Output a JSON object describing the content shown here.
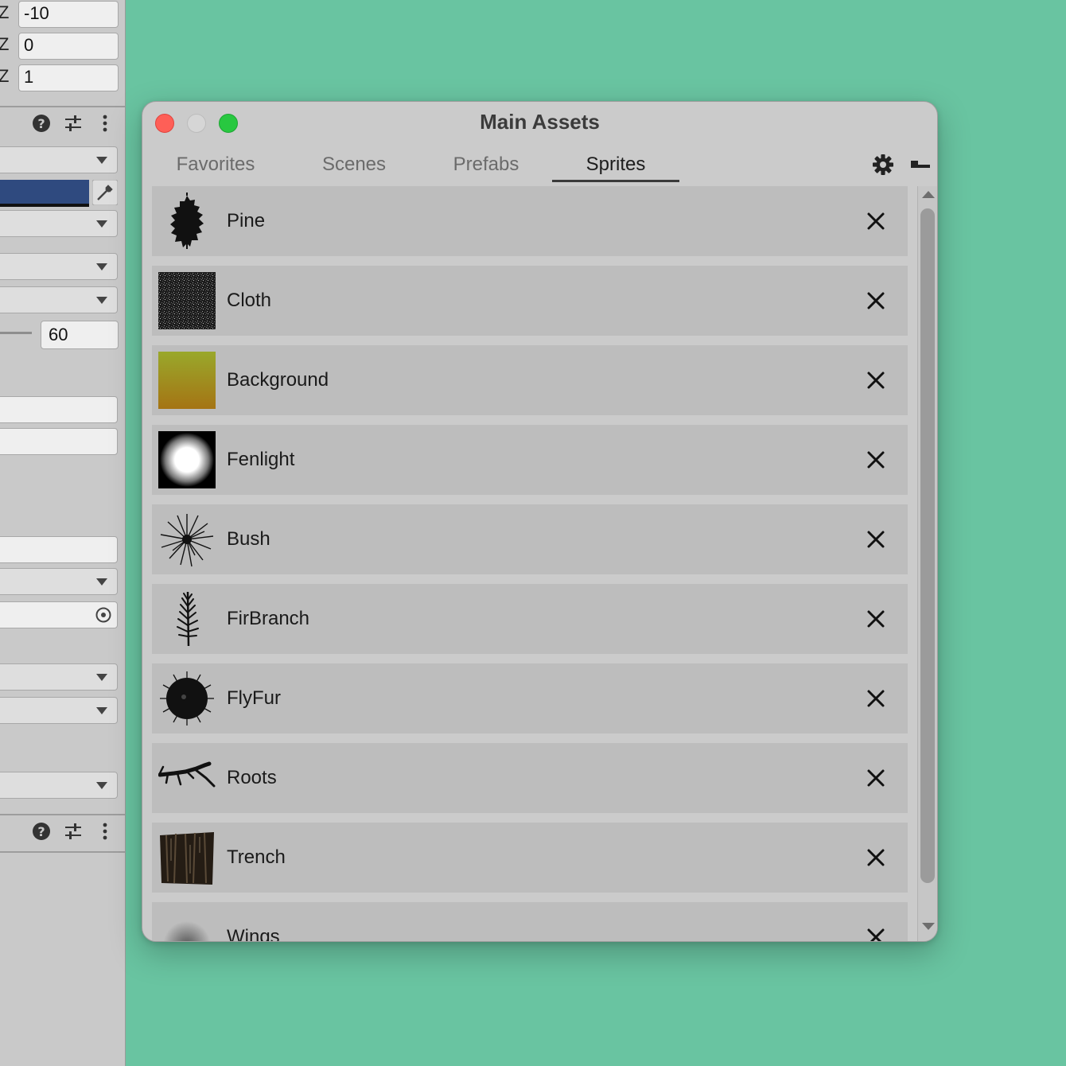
{
  "inspector": {
    "axis_label": "Z",
    "field_values": [
      "-10",
      "0",
      "1"
    ],
    "slider_value": "60",
    "color_swatch": "#2f4a7f"
  },
  "window": {
    "title": "Main Assets",
    "tabs": [
      {
        "label": "Favorites",
        "active": false
      },
      {
        "label": "Scenes",
        "active": false
      },
      {
        "label": "Prefabs",
        "active": false
      },
      {
        "label": "Sprites",
        "active": true
      }
    ]
  },
  "assets": [
    {
      "name": "Pine",
      "thumbnail": "pinecone-icon"
    },
    {
      "name": "Cloth",
      "thumbnail": "cloth-noise-texture"
    },
    {
      "name": "Background",
      "thumbnail": "olive-gradient-texture"
    },
    {
      "name": "Fenlight",
      "thumbnail": "soft-light-texture"
    },
    {
      "name": "Bush",
      "thumbnail": "bush-icon"
    },
    {
      "name": "FirBranch",
      "thumbnail": "fir-branch-icon"
    },
    {
      "name": "FlyFur",
      "thumbnail": "fur-ball-icon"
    },
    {
      "name": "Roots",
      "thumbnail": "roots-icon"
    },
    {
      "name": "Trench",
      "thumbnail": "bark-texture"
    },
    {
      "name": "Wings",
      "thumbnail": "wings-texture"
    }
  ],
  "colors": {
    "desktop": "#69c4a1",
    "close": "#fe5f57",
    "minimize_disabled": "#d6d6d6",
    "zoom": "#28c840"
  }
}
